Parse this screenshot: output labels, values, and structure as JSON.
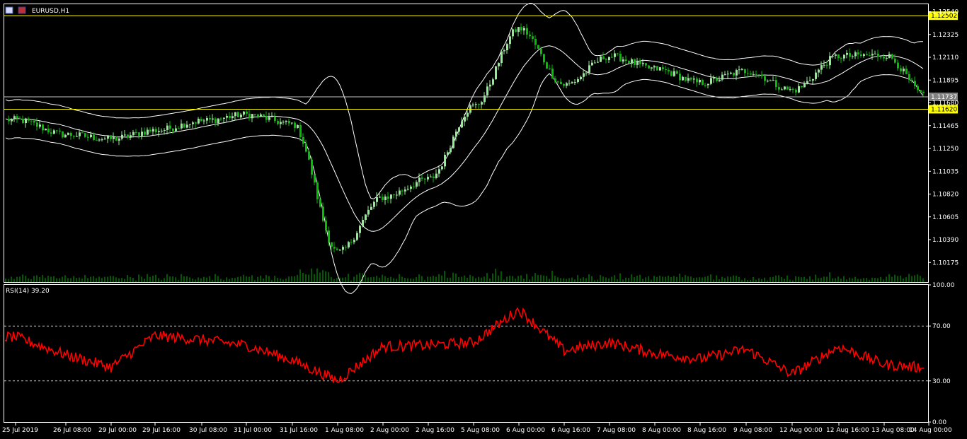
{
  "chart_title": "EURUSD,H1",
  "indicator_title": "RSI(14) 39.20",
  "colors": {
    "background": "#000000",
    "frame": "#ffffff",
    "bull_candle": "#90ee90",
    "bear_candle": "#00c000",
    "bollinger": "#ffffff",
    "horizontal_line": "#ffff00",
    "bid_line": "#c0c0c0",
    "rsi": "#ff0000",
    "rsi_levels": "#c0c0c0",
    "volume": "#00b000"
  },
  "chart_data": [
    {
      "type": "candlestick",
      "symbol": "EURUSD",
      "timeframe": "H1",
      "indicators": [
        "Bollinger Bands",
        "Volumes"
      ],
      "ylim": [
        1.0999,
        1.1261
      ],
      "y_ticks": [
        "1.12540",
        "1.12325",
        "1.12110",
        "1.11895",
        "1.11680",
        "1.11465",
        "1.11250",
        "1.11035",
        "1.10820",
        "1.10605",
        "1.10390",
        "1.10175"
      ],
      "x_ticks": [
        "25 Jul 2019",
        "26 Jul 08:00",
        "29 Jul 00:00",
        "29 Jul 16:00",
        "30 Jul 08:00",
        "31 Jul 00:00",
        "31 Jul 16:00",
        "1 Aug 08:00",
        "2 Aug 00:00",
        "2 Aug 16:00",
        "5 Aug 08:00",
        "6 Aug 00:00",
        "6 Aug 16:00",
        "7 Aug 08:00",
        "8 Aug 00:00",
        "8 Aug 16:00",
        "9 Aug 08:00",
        "12 Aug 00:00",
        "12 Aug 16:00",
        "13 Aug 08:00",
        "14 Aug 00:00"
      ],
      "horizontal_lines": [
        {
          "label": "1.12502",
          "value": 1.12502
        },
        {
          "label": "1.11620",
          "value": 1.1162
        }
      ],
      "bid_line": {
        "label": "1.11737",
        "value": 1.11737
      },
      "close_path": [
        [
          "25 Jul 2019",
          1.1152
        ],
        [
          "26 Jul 08:00",
          1.1138
        ],
        [
          "29 Jul 00:00",
          1.1134
        ],
        [
          "29 Jul 16:00",
          1.1142
        ],
        [
          "30 Jul 08:00",
          1.1151
        ],
        [
          "31 Jul 00:00",
          1.1157
        ],
        [
          "31 Jul 16:00",
          1.1148
        ],
        [
          "1 Aug 08:00",
          1.1027
        ],
        [
          "2 Aug 00:00",
          1.1079
        ],
        [
          "2 Aug 16:00",
          1.1096
        ],
        [
          "5 Aug 08:00",
          1.1165
        ],
        [
          "6 Aug 00:00",
          1.1238
        ],
        [
          "6 Aug 16:00",
          1.1185
        ],
        [
          "7 Aug 08:00",
          1.1212
        ],
        [
          "8 Aug 00:00",
          1.12
        ],
        [
          "8 Aug 16:00",
          1.1187
        ],
        [
          "9 Aug 08:00",
          1.1198
        ],
        [
          "12 Aug 00:00",
          1.118
        ],
        [
          "12 Aug 16:00",
          1.1212
        ],
        [
          "13 Aug 08:00",
          1.1213
        ],
        [
          "14 Aug 00:00",
          1.1172
        ]
      ]
    },
    {
      "type": "line",
      "name": "RSI(14)",
      "ylim": [
        0,
        100
      ],
      "y_ticks": [
        "100.00",
        "70.00",
        "30.00",
        "0.00"
      ],
      "levels": [
        70,
        30
      ],
      "x": [
        "25 Jul 2019",
        "26 Jul 08:00",
        "29 Jul 00:00",
        "29 Jul 16:00",
        "30 Jul 08:00",
        "31 Jul 00:00",
        "31 Jul 16:00",
        "1 Aug 08:00",
        "2 Aug 00:00",
        "2 Aug 16:00",
        "5 Aug 08:00",
        "6 Aug 00:00",
        "6 Aug 16:00",
        "7 Aug 08:00",
        "8 Aug 00:00",
        "8 Aug 16:00",
        "9 Aug 08:00",
        "12 Aug 00:00",
        "12 Aug 16:00",
        "13 Aug 08:00",
        "14 Aug 00:00"
      ],
      "values": [
        62,
        49,
        40,
        63,
        60,
        56,
        45,
        30,
        55,
        56,
        58,
        82,
        52,
        58,
        50,
        46,
        53,
        35,
        55,
        42,
        39.2
      ]
    }
  ]
}
